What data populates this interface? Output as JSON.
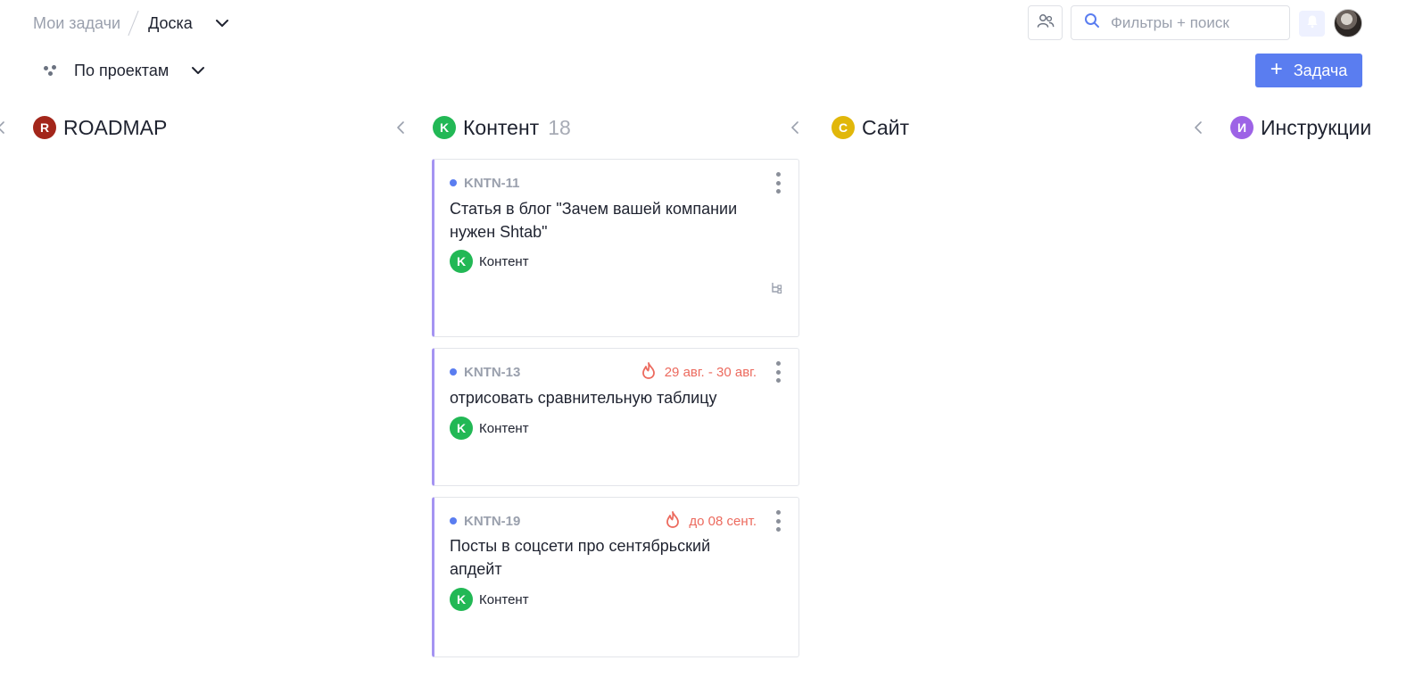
{
  "breadcrumb": {
    "parent": "Мои задачи",
    "current": "Доска"
  },
  "search": {
    "placeholder": "Фильтры + поиск"
  },
  "group_by": {
    "label": "По проектам"
  },
  "add_task": {
    "label": "Задача"
  },
  "columns": [
    {
      "badge": "R",
      "title": "ROADMAP",
      "count": "",
      "color": "#a3261b"
    },
    {
      "badge": "K",
      "title": "Контент",
      "count": "18",
      "color": "#22b855"
    },
    {
      "badge": "C",
      "title": "Сайт",
      "count": "",
      "color": "#e1b70a"
    },
    {
      "badge": "И",
      "title": "Инструкции",
      "count": "",
      "color": "#9d63e6"
    }
  ],
  "cards": [
    {
      "key": "KNTN-11",
      "title": "Статья в блог \"Зачем вашей компании нужен Shtab\"",
      "due": "",
      "project_badge": "K",
      "project": "Контент"
    },
    {
      "key": "KNTN-13",
      "title": "отрисовать сравнительную таблицу",
      "due": "29 авг. - 30 авг.",
      "project_badge": "K",
      "project": "Контент"
    },
    {
      "key": "KNTN-19",
      "title": "Посты в соцсети про сентябрьский апдейт",
      "due": "до 08 сент.",
      "project_badge": "K",
      "project": "Контент"
    }
  ],
  "colors": {
    "accent": "#5a7df0",
    "card_border": "#a594f2",
    "due": "#ec6a5e"
  }
}
